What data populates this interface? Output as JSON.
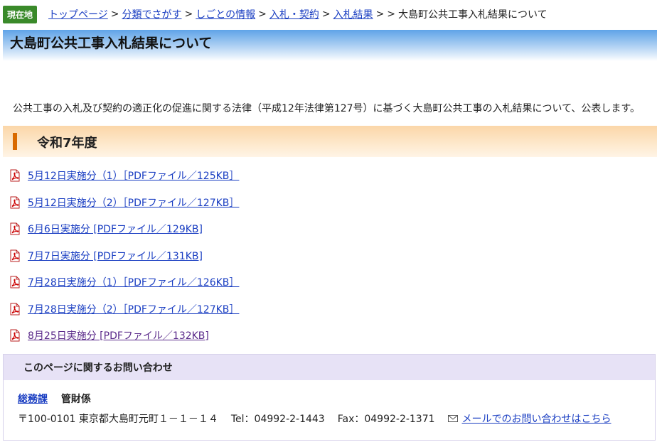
{
  "breadcrumb": {
    "badge": "現在地",
    "links": [
      "トップページ",
      "分類でさがす",
      "しごとの情報",
      "入札・契約",
      "入札結果"
    ],
    "separator": ">",
    "current_prefix": ">",
    "current": "大島町公共工事入札結果について"
  },
  "page": {
    "title": "大島町公共工事入札結果について",
    "intro": "公共工事の入札及び契約の適正化の促進に関する法律（平成12年法律第127号）に基づく大島町公共工事の入札結果について、公表します。"
  },
  "section": {
    "heading": "令和7年度",
    "accent_color": "#d96a00"
  },
  "files": [
    {
      "label": "5月12日実施分（1）［PDFファイル／125KB］"
    },
    {
      "label": "5月12日実施分（2）［PDFファイル／127KB］"
    },
    {
      "label": "6月6日実施分 [PDFファイル／129KB]"
    },
    {
      "label": "7月7日実施分 [PDFファイル／131KB]"
    },
    {
      "label": "7月28日実施分（1）［PDFファイル／126KB］"
    },
    {
      "label": "7月28日実施分（2）［PDFファイル／127KB］"
    },
    {
      "label": "8月25日実施分 [PDFファイル／132KB]"
    }
  ],
  "contact": {
    "heading": "このページに関するお問い合わせ",
    "dept": "総務課",
    "section": "管財係",
    "address": "〒100-0101 東京都大島町元町１－１－１４",
    "tel": "Tel：04992-2-1443",
    "fax": "Fax：04992-2-1371",
    "mail_link": "メールでのお問い合わせはこちら"
  },
  "icons": {
    "file": "pdf-icon",
    "mail": "mail-icon"
  },
  "colors": {
    "link": "#1a3ec2",
    "visited_link": "#5a2a8a",
    "badge": "#3a8a2a"
  }
}
